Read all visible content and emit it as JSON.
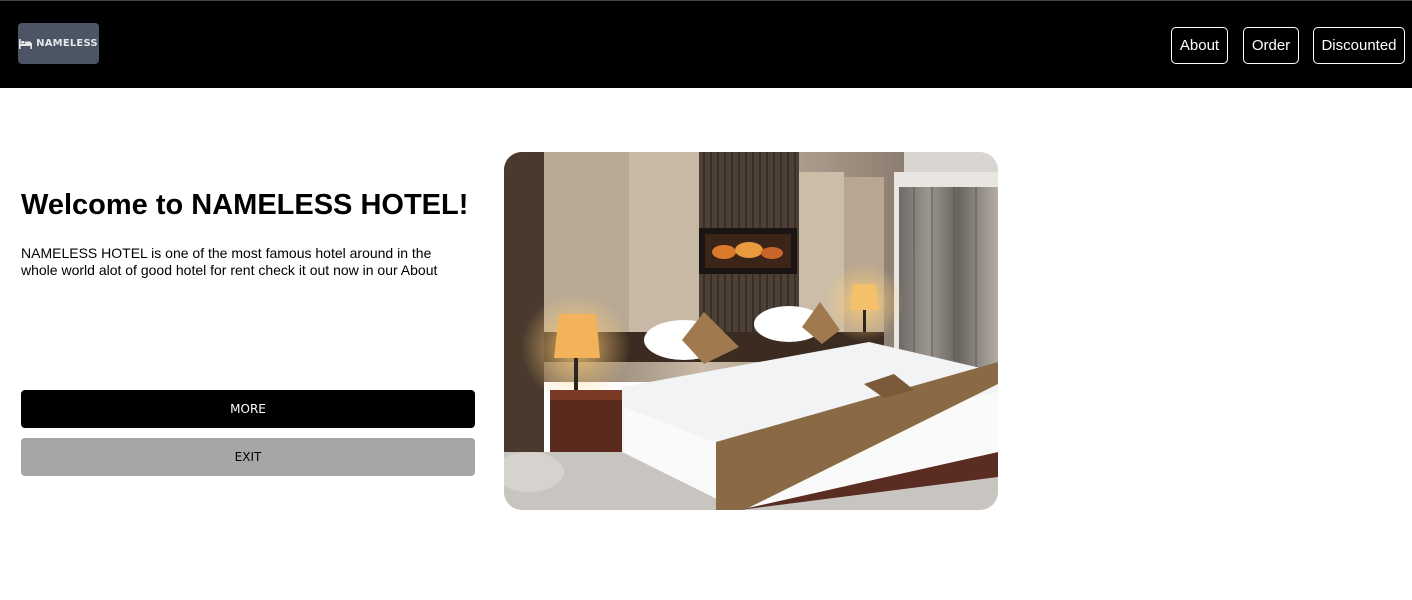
{
  "navbar": {
    "logo_text": "NAMELESS",
    "logo_icon": "bed-icon",
    "links": [
      {
        "label": "About"
      },
      {
        "label": "Order"
      },
      {
        "label": "Discounted"
      }
    ]
  },
  "hero": {
    "title": "Welcome to NAMELESS HOTEL!",
    "description": "NAMELESS HOTEL is one of the most famous hotel around in the whole world alot of good hotel for rent check it out now in our About",
    "more_label": "MORE",
    "exit_label": "EXIT",
    "image": "hotel-room-photo"
  },
  "colors": {
    "navbar_bg": "#000000",
    "logo_bg": "#4b5563",
    "more_bg": "#000000",
    "exit_bg": "#a6a6a6"
  }
}
